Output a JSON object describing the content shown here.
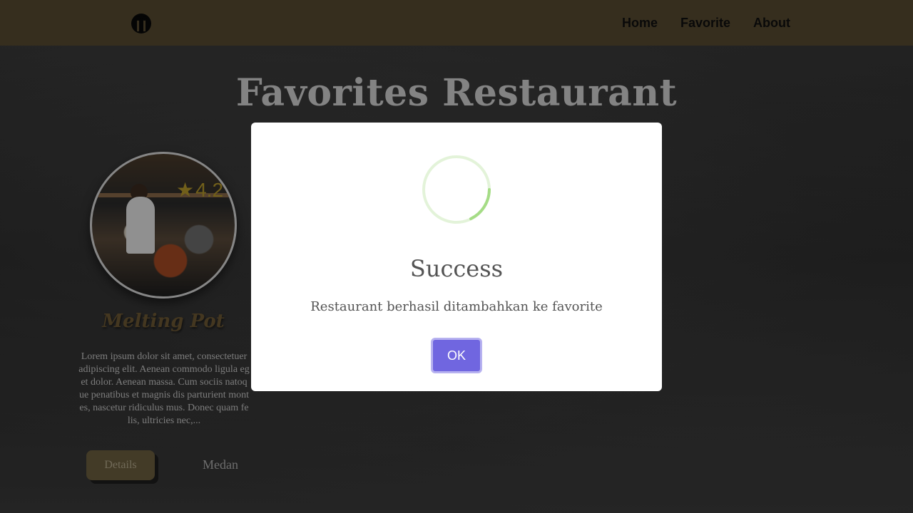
{
  "nav": {
    "logo_icon": "restaurant-logo-icon",
    "links": [
      "Home",
      "Favorite",
      "About"
    ]
  },
  "main": {
    "title": "Favorites Restaurant",
    "card": {
      "rating": "4.2",
      "name": "Melting Pot",
      "description": "Lorem ipsum dolor sit amet, consectetuer adipiscing elit. Aenean commodo ligula eget dolor. Aenean massa. Cum sociis natoque penatibus et magnis dis parturient montes, nascetur ridiculus mus. Donec quam felis, ultricies nec,...",
      "details_label": "Details",
      "city": "Medan"
    }
  },
  "modal": {
    "title": "Success",
    "message": "Restaurant berhasil ditambahkan ke favorite",
    "ok_label": "OK",
    "icon": "success-spinner-icon"
  },
  "colors": {
    "navbar": "#a08a5a",
    "accent": "#7066e0",
    "card_name": "#6e5a35",
    "rating": "#b79a2a"
  }
}
